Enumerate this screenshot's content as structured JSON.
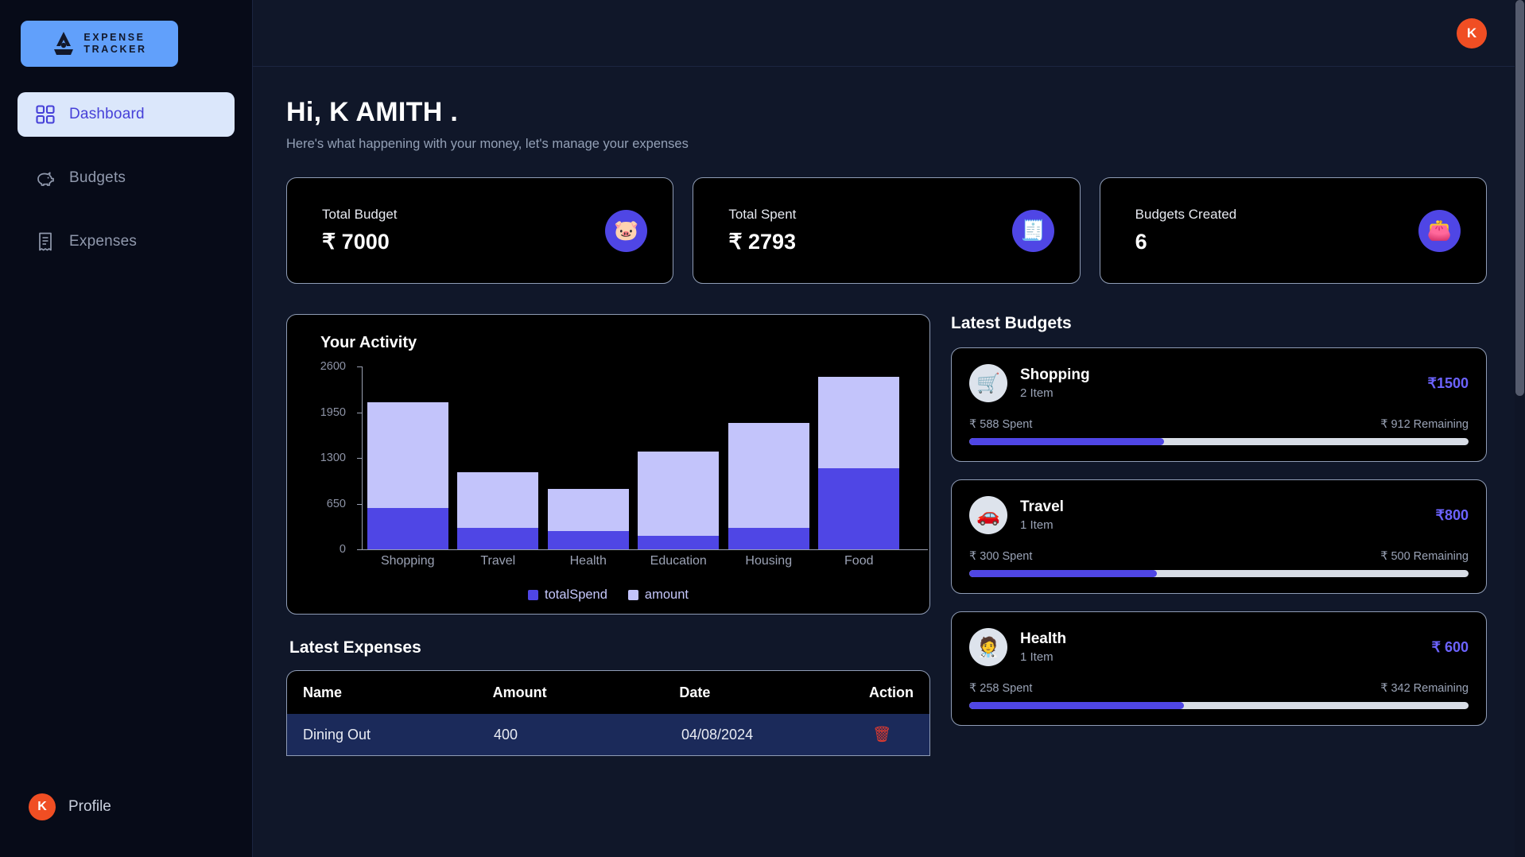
{
  "brand": {
    "line1": "EXPENSE",
    "line2": "TRACKER",
    "logo_icon": "mountain-logo-icon"
  },
  "sidebar": {
    "items": [
      {
        "label": "Dashboard",
        "icon": "grid-icon",
        "active": true
      },
      {
        "label": "Budgets",
        "icon": "piggy-bank-icon",
        "active": false
      },
      {
        "label": "Expenses",
        "icon": "receipt-icon",
        "active": false
      }
    ],
    "profile": {
      "label": "Profile",
      "initial": "K"
    }
  },
  "topbar": {
    "avatar_initial": "K"
  },
  "header": {
    "greeting": "Hi, K AMITH .",
    "subtitle": "Here's what happening with your money, let's manage your expenses"
  },
  "stats": [
    {
      "label": "Total Budget",
      "value": "₹ 7000",
      "icon": "piggy-bank-icon"
    },
    {
      "label": "Total Spent",
      "value": "₹ 2793",
      "icon": "receipt-icon"
    },
    {
      "label": "Budgets Created",
      "value": "6",
      "icon": "wallet-icon"
    }
  ],
  "activity": {
    "title": "Your Activity"
  },
  "chart_data": {
    "type": "bar",
    "stacked": true,
    "title": "Your Activity",
    "categories": [
      "Shopping",
      "Travel",
      "Health",
      "Education",
      "Housing",
      "Food"
    ],
    "series": [
      {
        "name": "totalSpend",
        "color": "#4f46e5",
        "values": [
          588,
          300,
          258,
          190,
          300,
          1157
        ]
      },
      {
        "name": "amount",
        "color": "#c3c4fb",
        "values": [
          1500,
          800,
          600,
          1200,
          1500,
          1300
        ]
      }
    ],
    "ylabel": "",
    "xlabel": "",
    "ylim": [
      0,
      2600
    ],
    "yticks": [
      0,
      650,
      1300,
      1950,
      2600
    ],
    "legend": [
      "totalSpend",
      "amount"
    ],
    "legend_position": "bottom",
    "grid": false
  },
  "latest_expenses": {
    "title": "Latest Expenses",
    "columns": [
      "Name",
      "Amount",
      "Date",
      "Action"
    ],
    "rows": [
      {
        "name": "Dining Out",
        "amount": "400",
        "date": "04/08/2024",
        "action_icon": "trash-icon"
      }
    ]
  },
  "latest_budgets": {
    "title": "Latest Budgets",
    "items": [
      {
        "name": "Shopping",
        "items": "2 Item",
        "amount": "₹1500",
        "icon": "shopping-cart-icon",
        "spent": "₹ 588 Spent",
        "remaining": "₹ 912 Remaining",
        "progress_pct": 39
      },
      {
        "name": "Travel",
        "items": "1 Item",
        "amount": "₹800",
        "icon": "car-icon",
        "spent": "₹ 300 Spent",
        "remaining": "₹ 500 Remaining",
        "progress_pct": 37.5
      },
      {
        "name": "Health",
        "items": "1 Item",
        "amount": "₹ 600",
        "icon": "doctor-icon",
        "spent": "₹ 258 Spent",
        "remaining": "₹ 342 Remaining",
        "progress_pct": 43
      }
    ]
  },
  "colors": {
    "accent": "#4f46e5",
    "bar_light": "#c3c4fb",
    "brand_blue": "#61a0fb",
    "avatar": "#f04e23",
    "page_bg": "#101729",
    "card_bg": "#000000"
  }
}
